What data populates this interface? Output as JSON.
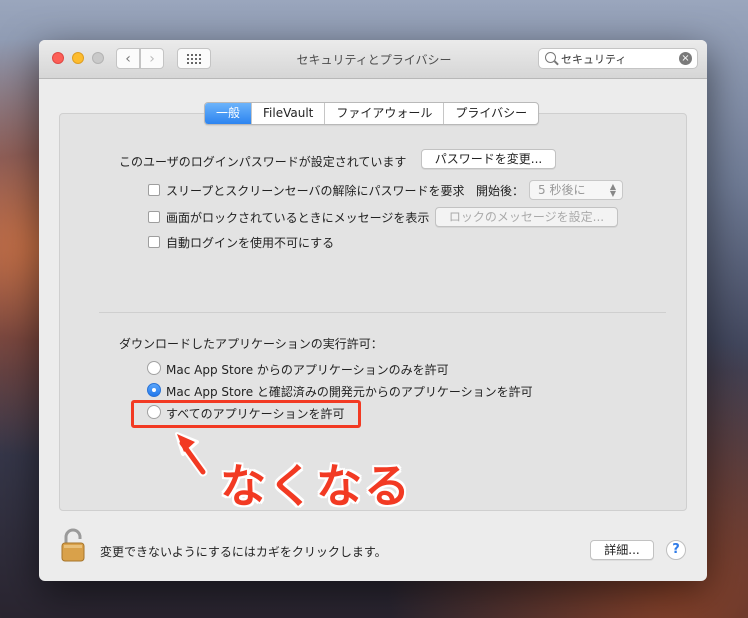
{
  "window": {
    "title": "セキュリティとプライバシー",
    "search": {
      "value": "セキュリティ",
      "clear_icon": "×"
    }
  },
  "tabs": [
    {
      "label": "一般",
      "active": true
    },
    {
      "label": "FileVault",
      "active": false
    },
    {
      "label": "ファイアウォール",
      "active": false
    },
    {
      "label": "プライバシー",
      "active": false
    }
  ],
  "general": {
    "password_set_text": "このユーザのログインパスワードが設定されています",
    "change_password_button": "パスワードを変更...",
    "require_password_label": "スリープとスクリーンセーバの解除にパスワードを要求",
    "require_password_checked": false,
    "after_label": "開始後：",
    "after_select_value": "5 秒後に",
    "show_message_label": "画面がロックされているときにメッセージを表示",
    "show_message_checked": false,
    "set_lock_message_button": "ロックのメッセージを設定...",
    "disable_autologin_label": "自動ログインを使用不可にする",
    "disable_autologin_checked": false
  },
  "downloads": {
    "heading": "ダウンロードしたアプリケーションの実行許可：",
    "options": [
      {
        "label": "Mac App Store からのアプリケーションのみを許可",
        "checked": false
      },
      {
        "label": "Mac App Store と確認済みの開発元からのアプリケーションを許可",
        "checked": true
      },
      {
        "label": "すべてのアプリケーションを許可",
        "checked": false
      }
    ]
  },
  "annotation": {
    "text": "なくなる",
    "color": "#f23a23"
  },
  "footer": {
    "lock_text": "変更できないようにするにはカギをクリックします。",
    "advanced_button": "詳細...",
    "help_label": "?"
  },
  "colors": {
    "accent": "#2c84f0",
    "annotation": "#f23a23",
    "close": "#fc5f57",
    "minimize": "#fdbc2e"
  }
}
